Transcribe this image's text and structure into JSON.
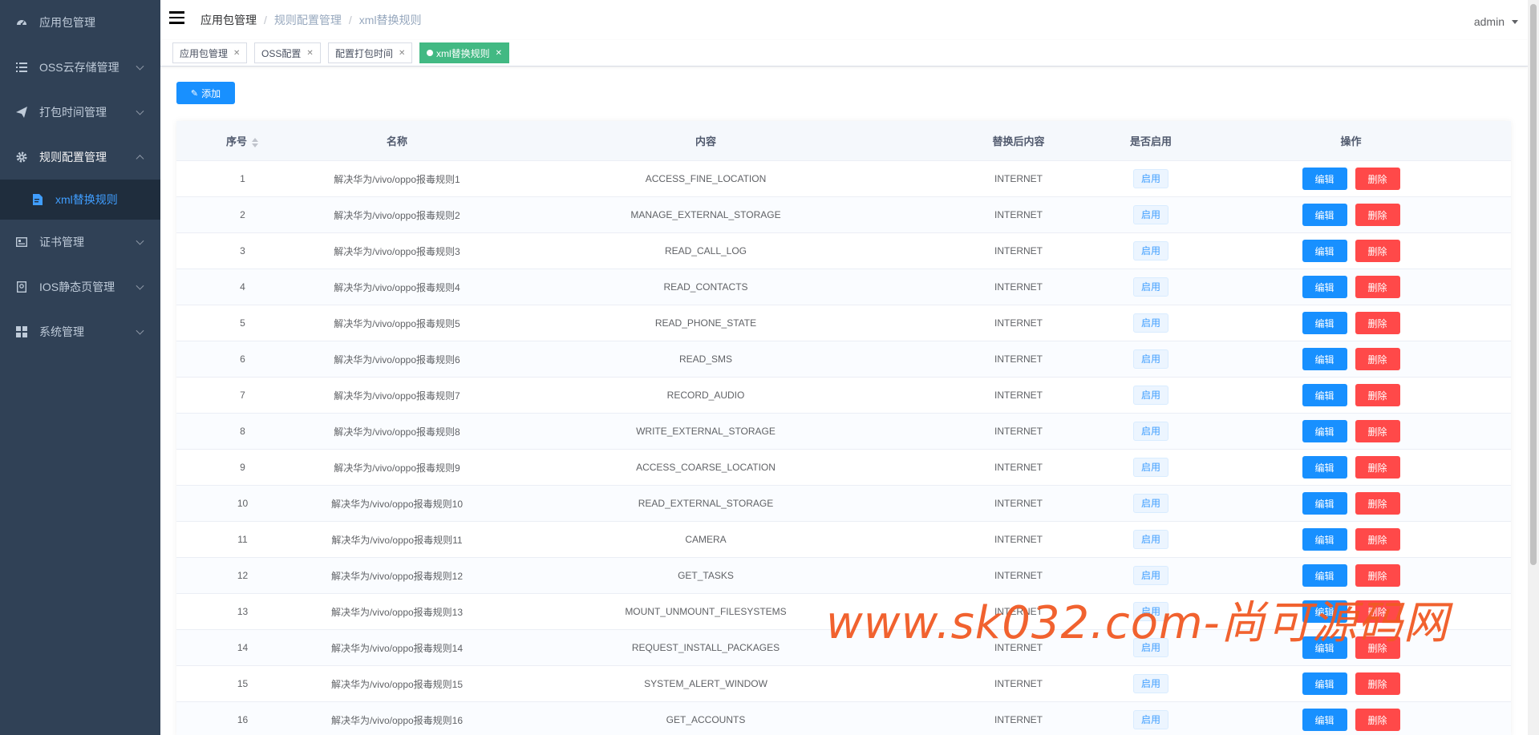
{
  "sidebar": {
    "items": [
      {
        "label": "应用包管理",
        "icon": "dashboard-icon",
        "expandable": false
      },
      {
        "label": "OSS云存储管理",
        "icon": "list-icon",
        "expandable": true
      },
      {
        "label": "打包时间管理",
        "icon": "send-icon",
        "expandable": true
      },
      {
        "label": "规则配置管理",
        "icon": "gear-icon",
        "expandable": true,
        "expanded": true
      },
      {
        "label": "证书管理",
        "icon": "certificate-icon",
        "expandable": true
      },
      {
        "label": "IOS静态页管理",
        "icon": "page-icon",
        "expandable": true
      },
      {
        "label": "系统管理",
        "icon": "grid-icon",
        "expandable": true
      }
    ],
    "sub_item": {
      "label": "xml替换规则",
      "icon": "document-icon"
    }
  },
  "header": {
    "breadcrumb": [
      "应用包管理",
      "规则配置管理",
      "xml替换规则"
    ],
    "user": "admin"
  },
  "tags": [
    {
      "label": "应用包管理",
      "active": false
    },
    {
      "label": "OSS配置",
      "active": false
    },
    {
      "label": "配置打包时间",
      "active": false
    },
    {
      "label": "xml替换规则",
      "active": true
    }
  ],
  "add_button": "添加",
  "table": {
    "headers": [
      "序号",
      "名称",
      "内容",
      "替换后内容",
      "是否启用",
      "操作"
    ],
    "rows": [
      {
        "no": "1",
        "name": "解决华为/vivo/oppo报毒规则1",
        "content": "ACCESS_FINE_LOCATION",
        "replace": "INTERNET",
        "status": "启用"
      },
      {
        "no": "2",
        "name": "解决华为/vivo/oppo报毒规则2",
        "content": "MANAGE_EXTERNAL_STORAGE",
        "replace": "INTERNET",
        "status": "启用"
      },
      {
        "no": "3",
        "name": "解决华为/vivo/oppo报毒规则3",
        "content": "READ_CALL_LOG",
        "replace": "INTERNET",
        "status": "启用"
      },
      {
        "no": "4",
        "name": "解决华为/vivo/oppo报毒规则4",
        "content": "READ_CONTACTS",
        "replace": "INTERNET",
        "status": "启用"
      },
      {
        "no": "5",
        "name": "解决华为/vivo/oppo报毒规则5",
        "content": "READ_PHONE_STATE",
        "replace": "INTERNET",
        "status": "启用"
      },
      {
        "no": "6",
        "name": "解决华为/vivo/oppo报毒规则6",
        "content": "READ_SMS",
        "replace": "INTERNET",
        "status": "启用"
      },
      {
        "no": "7",
        "name": "解决华为/vivo/oppo报毒规则7",
        "content": "RECORD_AUDIO",
        "replace": "INTERNET",
        "status": "启用"
      },
      {
        "no": "8",
        "name": "解决华为/vivo/oppo报毒规则8",
        "content": "WRITE_EXTERNAL_STORAGE",
        "replace": "INTERNET",
        "status": "启用"
      },
      {
        "no": "9",
        "name": "解决华为/vivo/oppo报毒规则9",
        "content": "ACCESS_COARSE_LOCATION",
        "replace": "INTERNET",
        "status": "启用"
      },
      {
        "no": "10",
        "name": "解决华为/vivo/oppo报毒规则10",
        "content": "READ_EXTERNAL_STORAGE",
        "replace": "INTERNET",
        "status": "启用"
      },
      {
        "no": "11",
        "name": "解决华为/vivo/oppo报毒规则11",
        "content": "CAMERA",
        "replace": "INTERNET",
        "status": "启用"
      },
      {
        "no": "12",
        "name": "解决华为/vivo/oppo报毒规则12",
        "content": "GET_TASKS",
        "replace": "INTERNET",
        "status": "启用"
      },
      {
        "no": "13",
        "name": "解决华为/vivo/oppo报毒规则13",
        "content": "MOUNT_UNMOUNT_FILESYSTEMS",
        "replace": "INTERNET",
        "status": "启用"
      },
      {
        "no": "14",
        "name": "解决华为/vivo/oppo报毒规则14",
        "content": "REQUEST_INSTALL_PACKAGES",
        "replace": "INTERNET",
        "status": "启用"
      },
      {
        "no": "15",
        "name": "解决华为/vivo/oppo报毒规则15",
        "content": "SYSTEM_ALERT_WINDOW",
        "replace": "INTERNET",
        "status": "启用"
      },
      {
        "no": "16",
        "name": "解决华为/vivo/oppo报毒规则16",
        "content": "GET_ACCOUNTS",
        "replace": "INTERNET",
        "status": "启用"
      }
    ],
    "edit_label": "编辑",
    "delete_label": "删除"
  },
  "watermark": "www.sk032.com-尚可源码网",
  "colors": {
    "sidebar_bg": "#304156",
    "primary": "#1890ff",
    "danger": "#ff4949",
    "tag_active": "#42b983"
  }
}
